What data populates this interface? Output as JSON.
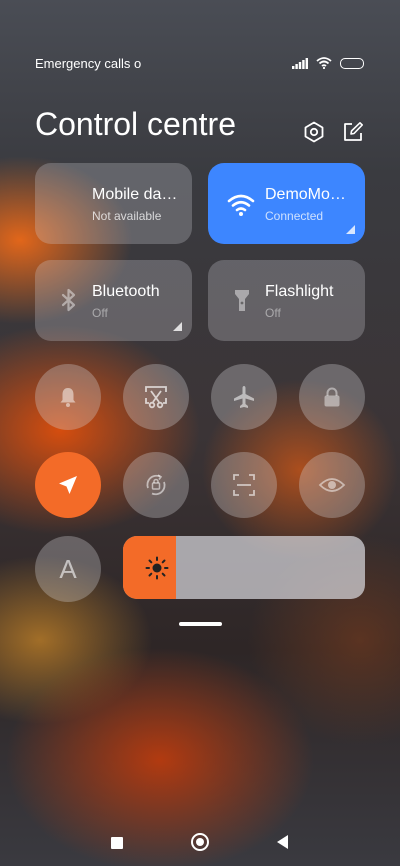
{
  "status_bar": {
    "carrier_text": "Emergency calls o",
    "icons": [
      "signal-icon",
      "wifi-icon",
      "battery-icon"
    ]
  },
  "header": {
    "title": "Control centre",
    "buttons": [
      "settings-icon",
      "edit-icon"
    ]
  },
  "tiles": {
    "mobile_data": {
      "title": "Mobile da…",
      "subtitle": "Not available",
      "active": false
    },
    "wifi": {
      "title": "DemoMo…",
      "subtitle": "Connected",
      "active": true
    },
    "bluetooth": {
      "title": "Bluetooth",
      "subtitle": "Off",
      "active": false
    },
    "flashlight": {
      "title": "Flashlight",
      "subtitle": "Off",
      "active": false
    }
  },
  "toggles": [
    {
      "name": "silent",
      "icon": "bell-icon",
      "active": false
    },
    {
      "name": "screenshot",
      "icon": "scissors-icon",
      "active": false
    },
    {
      "name": "airplane-mode",
      "icon": "airplane-icon",
      "active": false
    },
    {
      "name": "lock-screen",
      "icon": "lock-icon",
      "active": false
    },
    {
      "name": "location",
      "icon": "location-arrow-icon",
      "active": true
    },
    {
      "name": "rotation-lock",
      "icon": "rotation-lock-icon",
      "active": false
    },
    {
      "name": "scanner",
      "icon": "scan-icon",
      "active": false
    },
    {
      "name": "reading-mode",
      "icon": "eye-icon",
      "active": false
    },
    {
      "name": "auto-brightness",
      "icon": "auto-brightness-icon",
      "active": false
    }
  ],
  "auto_brightness_label": "A",
  "brightness": {
    "level_percent": 22
  },
  "colors": {
    "accent_blue": "#3d86ff",
    "accent_orange": "#f36b28"
  },
  "nav_bar": [
    "recents-icon",
    "home-icon",
    "back-icon"
  ]
}
